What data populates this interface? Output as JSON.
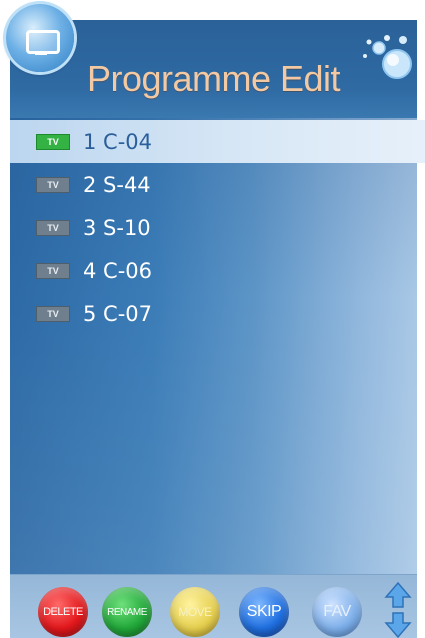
{
  "header": {
    "title": "Programme Edit"
  },
  "channels": [
    {
      "badge": "TV",
      "label": "1 C-04",
      "selected": true
    },
    {
      "badge": "TV",
      "label": "2 S-44",
      "selected": false
    },
    {
      "badge": "TV",
      "label": "3 S-10",
      "selected": false
    },
    {
      "badge": "TV",
      "label": "4 C-06",
      "selected": false
    },
    {
      "badge": "TV",
      "label": "5 C-07",
      "selected": false
    }
  ],
  "footer": {
    "delete_label": "DELETE",
    "rename_label": "RENAME",
    "move_label": "MOVE",
    "skip_label": "SKIP",
    "fav_label": "FAV"
  },
  "icons": {
    "app": "tv-icon",
    "decoration": "bubbles-icon",
    "scroll": "up-down-arrows-icon"
  },
  "colors": {
    "title": "#f2c9a2",
    "selected_row": "#d9e8f6",
    "selected_badge": "#35b244",
    "badge": "#6f7f8d",
    "delete": "#e2181c",
    "rename": "#22a83a",
    "move": "#e6d050",
    "skip": "#1f6fe0",
    "fav": "#7fb0ea"
  }
}
